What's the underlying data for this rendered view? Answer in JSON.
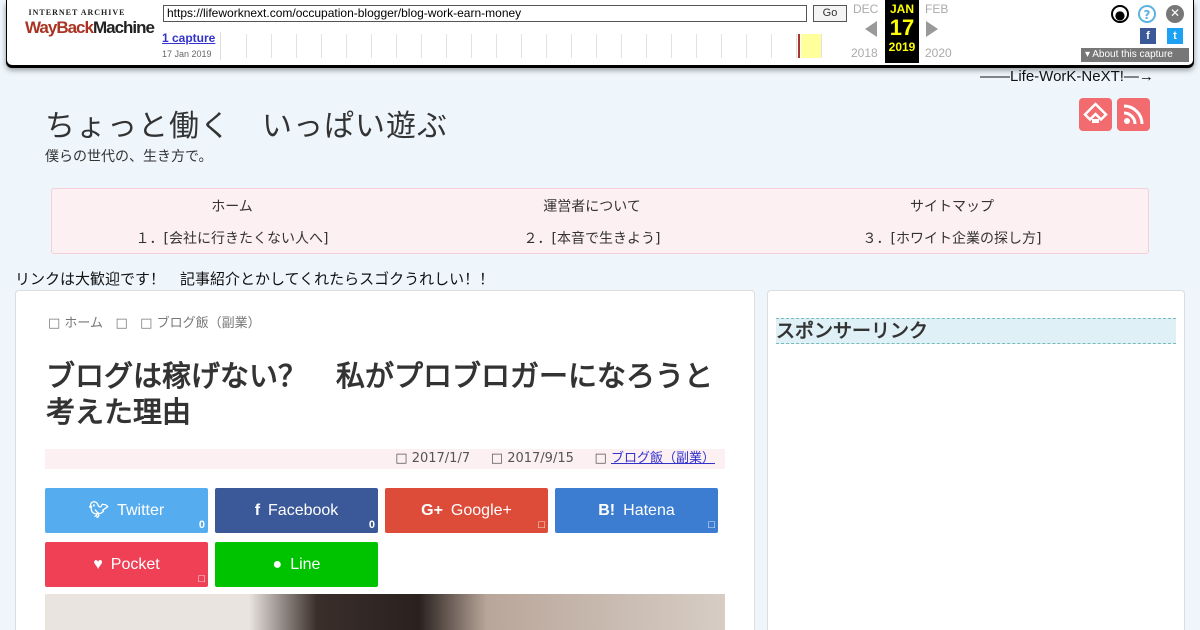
{
  "wayback": {
    "logo_line1": "INTERNET ARCHIVE",
    "logo_wayback": "WayBack",
    "logo_machine": "Machine",
    "url": "https://lifeworknext.com/occupation-blogger/blog-work-earn-money",
    "go_label": "Go",
    "captures": "1 capture",
    "capture_date": "17 Jan 2019",
    "prev_month": "DEC",
    "cur_month": "JAN",
    "next_month": "FEB",
    "cur_day": "17",
    "prev_year": "2018",
    "cur_year": "2019",
    "next_year": "2020",
    "about_label": "About this capture",
    "icons": [
      "user-icon",
      "help-icon",
      "close-icon",
      "facebook-icon",
      "twitter-icon"
    ]
  },
  "site": {
    "tagline_top": "——Life-WorK-NeXT!—→",
    "title": "ちょっと働く　いっぱい遊ぶ",
    "description": "僕らの世代の、生き方で。",
    "nav": [
      {
        "label": "ホーム"
      },
      {
        "label": "運営者について"
      },
      {
        "label": "サイトマップ"
      },
      {
        "label": "１．[会社に行きたくない人へ]"
      },
      {
        "label": "２．[本音で生きよう]"
      },
      {
        "label": "３．[ホワイト企業の探し方]"
      }
    ],
    "notice": "リンクは大歓迎です！　記事紹介とかしてくれたらスゴクうれしい！！",
    "accent_color": "#f16b6f"
  },
  "post": {
    "breadcrumb_home": " ホーム",
    "breadcrumb_sep": "",
    "breadcrumb_cat": " ブログ飯（副業）",
    "title": "ブログは稼げない？　私がプロブロガーになろうと考えた理由",
    "date_published": " 2017/1/7",
    "date_updated": " 2017/9/15",
    "category": "ブログ飯（副業）"
  },
  "share": {
    "twitter": {
      "label": "Twitter",
      "count": "0"
    },
    "facebook": {
      "label": "Facebook",
      "count": "0"
    },
    "google": {
      "label": "Google+",
      "count": ""
    },
    "hatena": {
      "label": "Hatena",
      "count": ""
    },
    "pocket": {
      "label": "Pocket",
      "count": ""
    },
    "line": {
      "label": "Line"
    }
  },
  "sidebar": {
    "sponsor_heading": "スポンサーリンク"
  }
}
